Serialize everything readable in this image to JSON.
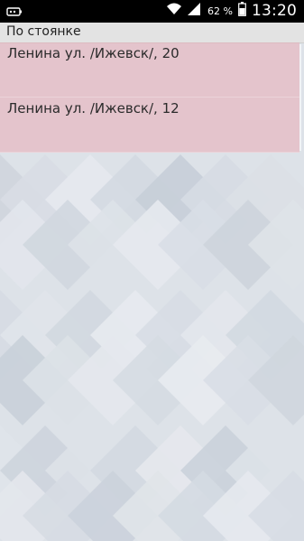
{
  "status_bar": {
    "battery_percent": "62 %",
    "time": "13:20",
    "icons": [
      "notification-icon",
      "wifi-icon",
      "signal-icon",
      "battery-icon"
    ]
  },
  "header": {
    "title": "По стоянке"
  },
  "list": {
    "items": [
      {
        "label": "Ленина ул. /Ижевск/, 20"
      },
      {
        "label": "Ленина ул. /Ижевск/, 12"
      }
    ]
  },
  "colors": {
    "status_bar": "#000000",
    "header_bg": "#e3e3e3",
    "item_bg": "#e9abb5",
    "background": "#dfe3e9"
  }
}
